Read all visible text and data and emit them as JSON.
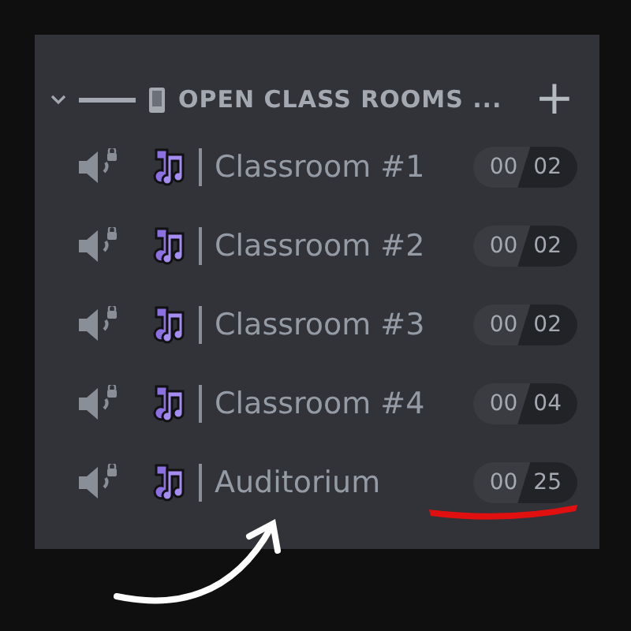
{
  "category": {
    "name": "OPEN CLASS ROOMS ...",
    "expanded": true,
    "add_button": "+"
  },
  "channels": [
    {
      "name": "Classroom #1",
      "connected": "00",
      "limit": "02"
    },
    {
      "name": "Classroom #2",
      "connected": "00",
      "limit": "02"
    },
    {
      "name": "Classroom #3",
      "connected": "00",
      "limit": "02"
    },
    {
      "name": "Classroom #4",
      "connected": "00",
      "limit": "04"
    },
    {
      "name": "Auditorium",
      "connected": "00",
      "limit": "25"
    }
  ]
}
